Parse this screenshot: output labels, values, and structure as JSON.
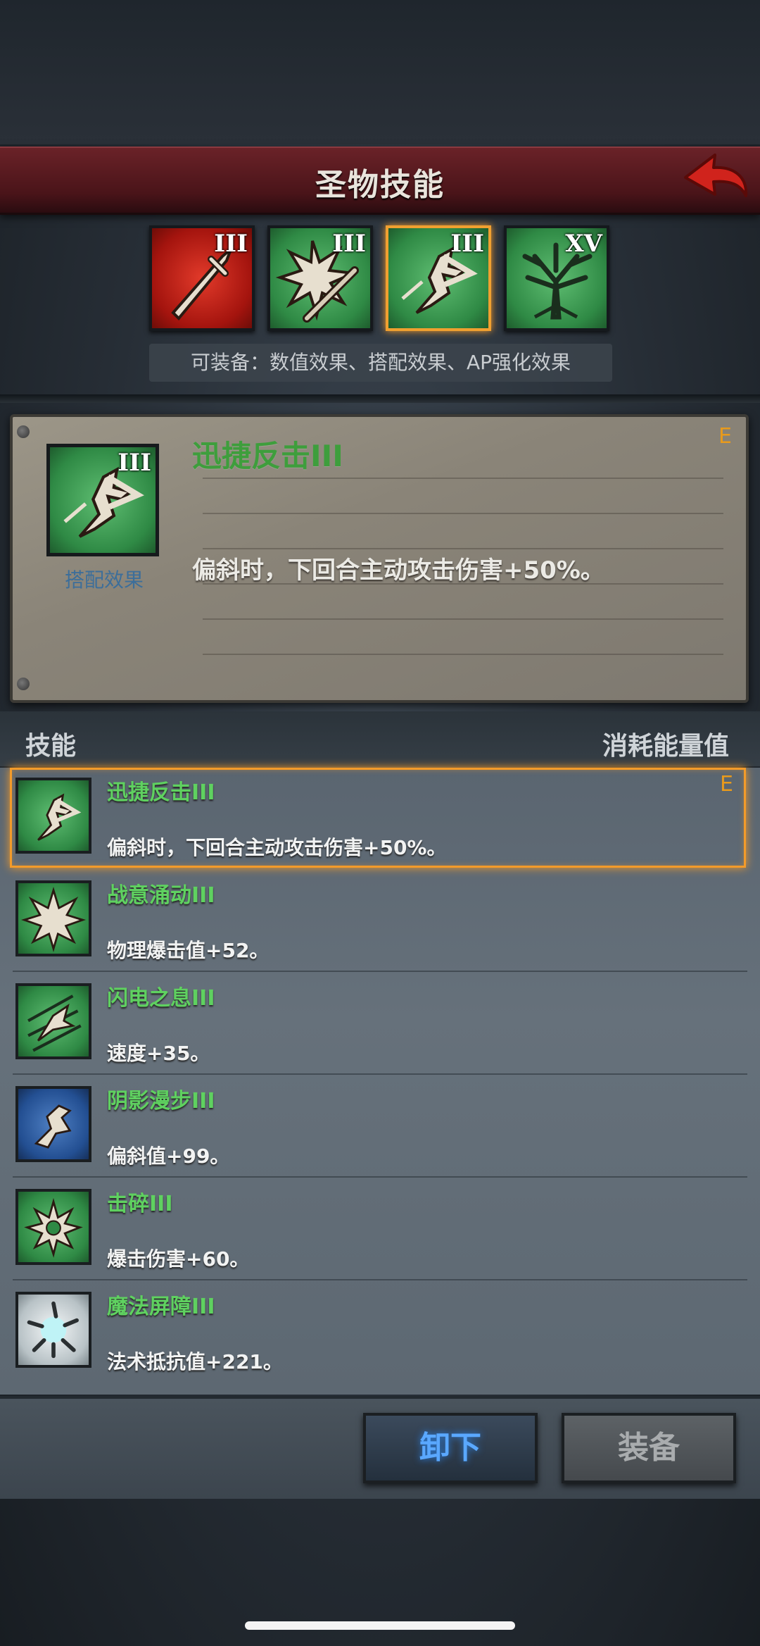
{
  "header": {
    "title": "圣物技能",
    "back_icon": "back-arrow-icon"
  },
  "tabs": [
    {
      "icon": "sword-icon",
      "numeral": "III",
      "color": "red",
      "selected": false
    },
    {
      "icon": "burst-sword-icon",
      "numeral": "III",
      "color": "green",
      "selected": false
    },
    {
      "icon": "dash-strike-icon",
      "numeral": "III",
      "color": "green",
      "selected": true
    },
    {
      "icon": "tree-icon",
      "numeral": "XV",
      "color": "green",
      "selected": false
    }
  ],
  "hint": "可装备：数值效果、搭配效果、AP强化效果",
  "detail": {
    "icon": "dash-strike-icon",
    "numeral": "III",
    "caption": "搭配效果",
    "title": "迅捷反击III",
    "grade": "E",
    "description": "偏斜时，下回合主动攻击伤害+50%。"
  },
  "list_header": {
    "left": "技能",
    "right": "消耗能量值"
  },
  "skills": [
    {
      "name": "迅捷反击III",
      "effect": "偏斜时，下回合主动攻击伤害+50%。",
      "grade": "E",
      "icon": "dash-strike-icon",
      "selected": true
    },
    {
      "name": "战意涌动III",
      "effect": "物理爆击值+52。",
      "grade": "",
      "icon": "starburst-icon",
      "selected": false
    },
    {
      "name": "闪电之息III",
      "effect": "速度+35。",
      "grade": "",
      "icon": "lightning-dash-icon",
      "selected": false
    },
    {
      "name": "阴影漫步III",
      "effect": "偏斜值+99。",
      "grade": "",
      "icon": "shadow-step-icon",
      "selected": false
    },
    {
      "name": "击碎III",
      "effect": "爆击伤害+60。",
      "grade": "",
      "icon": "shatter-icon",
      "selected": false
    },
    {
      "name": "魔法屏障III",
      "effect": "法术抵抗值+221。",
      "grade": "",
      "icon": "magic-barrier-icon",
      "selected": false
    }
  ],
  "buttons": {
    "unequip": "卸下",
    "equip": "装备"
  }
}
